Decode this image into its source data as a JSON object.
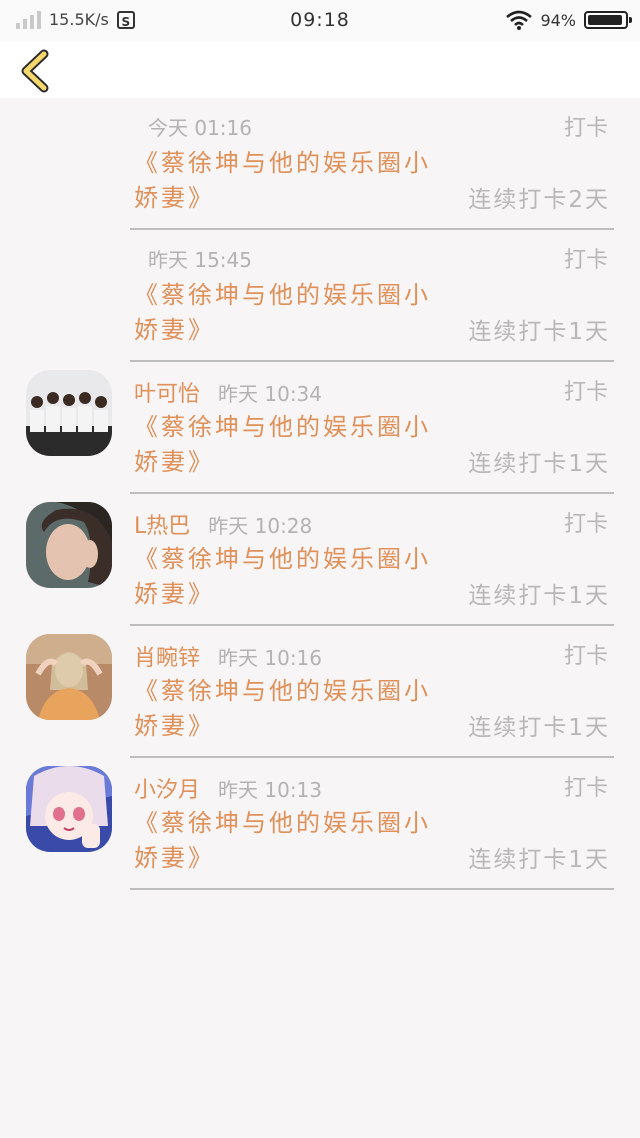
{
  "status_bar": {
    "net_speed": "15.5K/s",
    "time": "09:18",
    "battery_percent": "94%",
    "battery_level": 0.94
  },
  "nav": {
    "back_icon": "chevron-left-icon"
  },
  "rows": [
    {
      "name": "",
      "time": "今天 01:16",
      "punch": "打卡",
      "title": "《蔡徐坤与他的娱乐圈小娇妻》",
      "streak": "连续打卡2天",
      "avatar": ""
    },
    {
      "name": "",
      "time": "昨天 15:45",
      "punch": "打卡",
      "title": "《蔡徐坤与他的娱乐圈小娇妻》",
      "streak": "连续打卡1天",
      "avatar": ""
    },
    {
      "name": "叶可怡",
      "time": "昨天 10:34",
      "punch": "打卡",
      "title": "《蔡徐坤与他的娱乐圈小娇妻》",
      "streak": "连续打卡1天",
      "avatar": "group-photo"
    },
    {
      "name": "L热巴",
      "time": "昨天 10:28",
      "punch": "打卡",
      "title": "《蔡徐坤与他的娱乐圈小娇妻》",
      "streak": "连续打卡1天",
      "avatar": "portrait-photo"
    },
    {
      "name": "肖畹锌",
      "time": "昨天 10:16",
      "punch": "打卡",
      "title": "《蔡徐坤与他的娱乐圈小娇妻》",
      "streak": "连续打卡1天",
      "avatar": "selfie-photo"
    },
    {
      "name": "小汐月",
      "time": "昨天 10:13",
      "punch": "打卡",
      "title": "《蔡徐坤与他的娱乐圈小娇妻》",
      "streak": "连续打卡1天",
      "avatar": "anime-photo"
    }
  ],
  "colors": {
    "accent": "#e0915a",
    "muted": "#b8b8b8",
    "divider": "#bdbdbd",
    "background": "#f7f5f5"
  }
}
